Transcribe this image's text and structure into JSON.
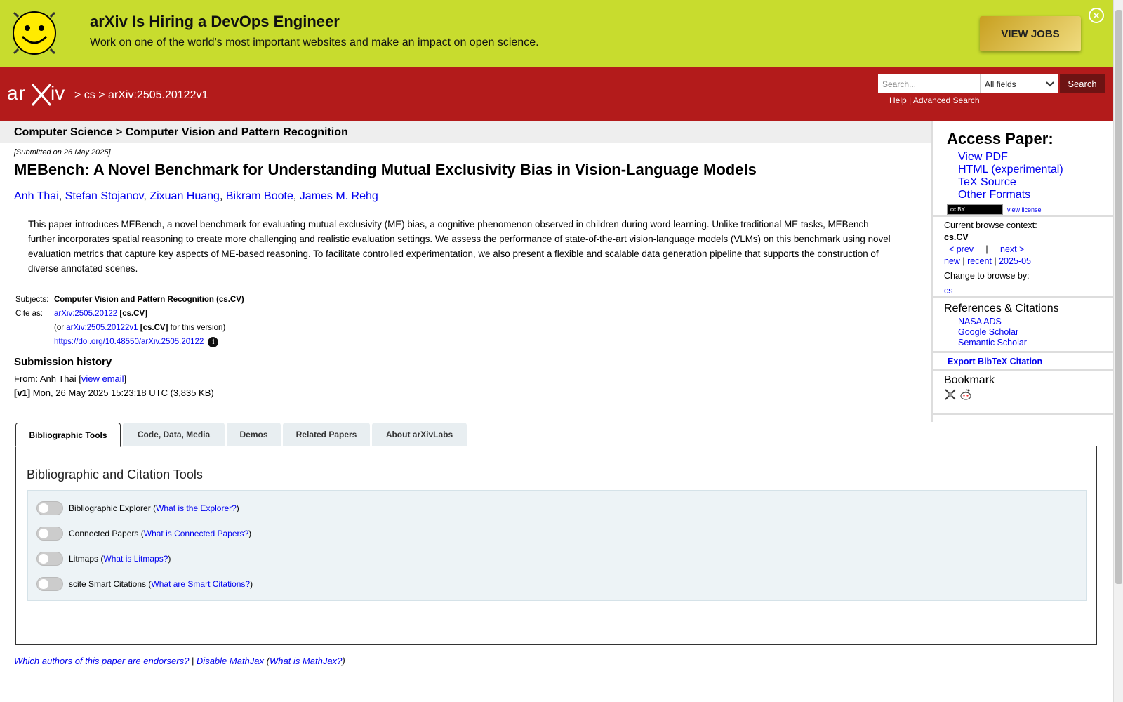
{
  "banner": {
    "title": "arXiv Is Hiring a DevOps Engineer",
    "text": "Work on one of the world's most important websites and make an impact on open science.",
    "button": "VIEW JOBS"
  },
  "header": {
    "breadcrumb_cs": "cs",
    "breadcrumb_id": "arXiv:2505.20122v1",
    "search_placeholder": "Search...",
    "field_select": "All fields",
    "search_button": "Search",
    "help": "Help",
    "advanced": "Advanced Search"
  },
  "subheader": "Computer Science > Computer Vision and Pattern Recognition",
  "paper": {
    "submitted": "[Submitted on 26 May 2025]",
    "title": "MEBench: A Novel Benchmark for Understanding Mutual Exclusivity Bias in Vision-Language Models",
    "authors": [
      "Anh Thai",
      "Stefan Stojanov",
      "Zixuan Huang",
      "Bikram Boote",
      "James M. Rehg"
    ],
    "abstract": "This paper introduces MEBench, a novel benchmark for evaluating mutual exclusivity (ME) bias, a cognitive phenomenon observed in children during word learning. Unlike traditional ME tasks, MEBench further incorporates spatial reasoning to create more challenging and realistic evaluation settings. We assess the performance of state-of-the-art vision-language models (VLMs) on this benchmark using novel evaluation metrics that capture key aspects of ME-based reasoning. To facilitate controlled experimentation, we also present a flexible and scalable data generation pipeline that supports the construction of diverse annotated scenes.",
    "subjects_label": "Subjects:",
    "subjects": "Computer Vision and Pattern Recognition (cs.CV)",
    "cite_label": "Cite as:",
    "cite_id": "arXiv:2505.20122",
    "cite_cat": "[cs.CV]",
    "cite_or": "(or",
    "cite_version": "arXiv:2505.20122v1",
    "cite_version_cat": "[cs.CV]",
    "cite_for": "for this version)",
    "doi": "https://doi.org/10.48550/arXiv.2505.20122",
    "history_title": "Submission history",
    "from_prefix": "From: Anh Thai [",
    "view_email": "view email",
    "from_suffix": "]",
    "v1_label": "[v1]",
    "v1_text": "Mon, 26 May 2025 15:23:18 UTC (3,835 KB)"
  },
  "tabs": [
    "Bibliographic Tools",
    "Code, Data, Media",
    "Demos",
    "Related Papers",
    "About arXivLabs"
  ],
  "tools": {
    "title": "Bibliographic and Citation Tools",
    "items": [
      {
        "label": "Bibliographic Explorer",
        "link": "What is the Explorer?"
      },
      {
        "label": "Connected Papers",
        "link": "What is Connected Papers?"
      },
      {
        "label": "Litmaps",
        "link": "What is Litmaps?"
      },
      {
        "label": "scite Smart Citations",
        "link": "What are Smart Citations?"
      }
    ]
  },
  "footer": {
    "endorsers": "Which authors of this paper are endorsers?",
    "sep": " | ",
    "mathjax": "Disable MathJax",
    "what_mathjax": "What is MathJax?"
  },
  "sidebar": {
    "access_title": "Access Paper:",
    "links": [
      "View PDF",
      "HTML (experimental)",
      "TeX Source",
      "Other Formats"
    ],
    "cc": "cc BY",
    "view_license": "view license",
    "context_label": "Current browse context:",
    "context": "cs.CV",
    "prev": "< prev",
    "next": "next >",
    "new": "new",
    "recent": "recent",
    "month": "2025-05",
    "change_label": "Change to browse by:",
    "cs": "cs",
    "refs_title": "References & Citations",
    "refs": [
      "NASA ADS",
      "Google Scholar",
      "Semantic Scholar"
    ],
    "bibtex": "Export BibTeX Citation",
    "bookmark_title": "Bookmark"
  },
  "colors": {
    "banner": "#c8dc2e",
    "header": "#b31b1b",
    "link": "#0000ee"
  }
}
